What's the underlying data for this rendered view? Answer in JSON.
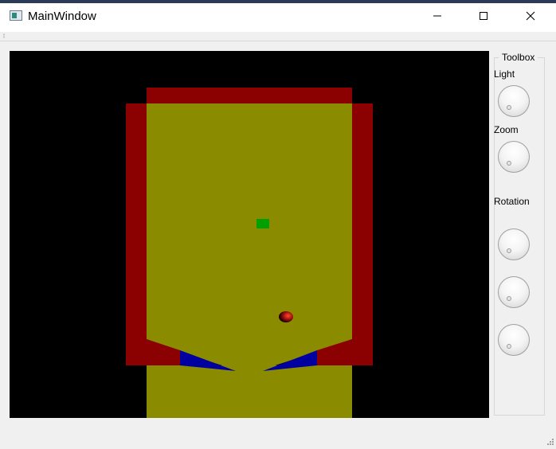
{
  "window": {
    "title": "MainWindow",
    "controls": {
      "minimize_icon": "minimize-icon",
      "maximize_icon": "maximize-icon",
      "close_icon": "close-icon"
    }
  },
  "toolbox": {
    "title": "Toolbox",
    "light_label": "Light",
    "zoom_label": "Zoom",
    "rotation_label": "Rotation"
  },
  "scene": {
    "background_color": "#000000",
    "wall_color": "#8b0000",
    "floor_color": "#8b8b00",
    "flipper_color": "#0000a0",
    "target_color": "#00a000",
    "ball_color": "#c01010"
  }
}
